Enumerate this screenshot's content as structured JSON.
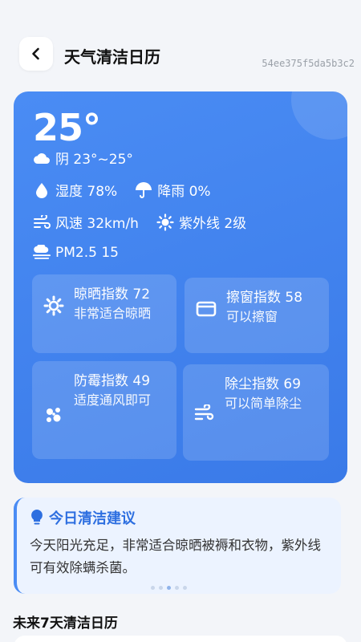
{
  "header": {
    "title": "天气清洁日历",
    "id_text": "54ee375f5da5b3c2"
  },
  "weather": {
    "temperature": "25°",
    "condition": "阴 23°~25°",
    "humidity": "湿度 78%",
    "rain": "降雨 0%",
    "wind": "风速 32km/h",
    "uv": "紫外线 2级",
    "pm25": "PM2.5 15"
  },
  "indices": [
    {
      "title": "晾晒指数 72",
      "desc": "非常适合晾晒",
      "icon": "sun-gear-icon"
    },
    {
      "title": "擦窗指数 58",
      "desc": "可以擦窗",
      "icon": "window-icon"
    },
    {
      "title": "防霉指数 49",
      "desc": "适度通风即可",
      "icon": "mold-icon"
    },
    {
      "title": "除尘指数 69",
      "desc": "可以简单除尘",
      "icon": "dust-wind-icon"
    }
  ],
  "suggestion": {
    "title": "今日清洁建议",
    "text": "今天阳光充足，非常适合晾晒被褥和衣物，紫外线可有效除螨杀菌。"
  },
  "section": {
    "title": "未来7天清洁日历"
  },
  "colors": {
    "card_blue": "#4a8cf4",
    "accent": "#2e6fe0",
    "background": "#f3f5f9"
  }
}
